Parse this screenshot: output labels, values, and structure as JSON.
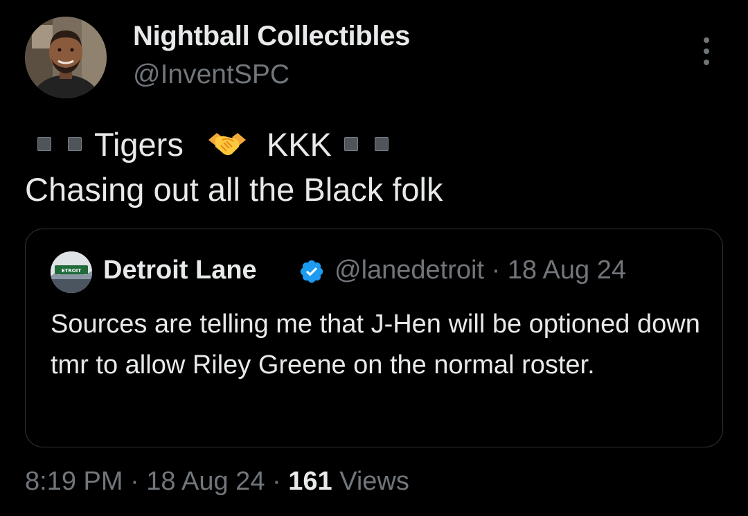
{
  "author": {
    "name": "Nightball Collectibles",
    "handle": "@InventSPC"
  },
  "tweet": {
    "line1_word1": "Tigers",
    "line1_word2": "KKK",
    "line2": "Chasing out all the Black folk",
    "icons": [
      "black-small-square-icon",
      "black-small-square-icon",
      "handshake-icon",
      "black-small-square-icon",
      "black-small-square-icon"
    ]
  },
  "quote": {
    "name": "Detroit Lane",
    "meta": "@lanedetroit · 18 Aug 24",
    "text": "Sources are telling me that J-Hen will be optioned down tmr to allow Riley Greene on the normal roster.",
    "avatar_sign": "ETROIT"
  },
  "footer": {
    "time_date": "8:19 PM · 18 Aug 24 · ",
    "views_count": "161",
    "views_label": " Views"
  },
  "colors": {
    "background": "#000000",
    "primary_text": "#e7e9ea",
    "secondary_text": "#71767b",
    "border": "#2f3336",
    "verified": "#1d9bf0"
  }
}
